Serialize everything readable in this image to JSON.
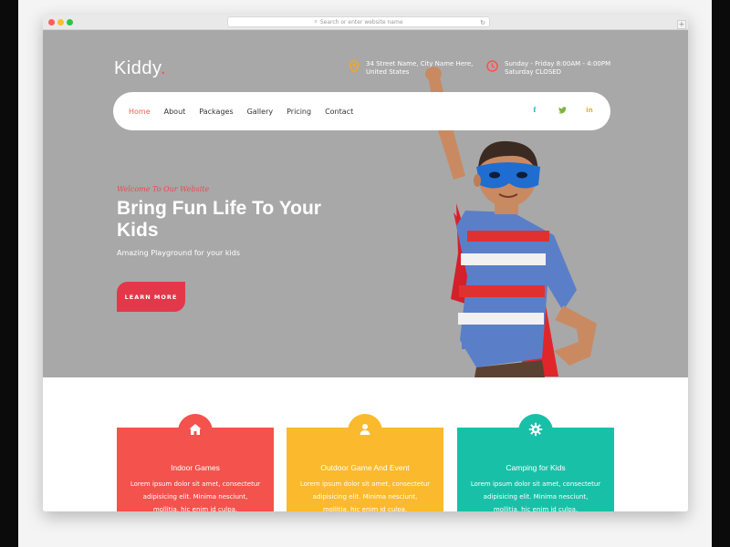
{
  "browser": {
    "address_placeholder": "Search or enter website name"
  },
  "header": {
    "logo_text": "Kiddy",
    "logo_dot": ".",
    "address_line1": "34 Street Name, City Name Here,",
    "address_line2": "United States",
    "hours_line1": "Sunday - Friday 8:00AM - 4:00PM",
    "hours_line2": "Saturday CLOSED"
  },
  "nav": {
    "items": [
      {
        "label": "Home",
        "active": true
      },
      {
        "label": "About",
        "active": false
      },
      {
        "label": "Packages",
        "active": false
      },
      {
        "label": "Gallery",
        "active": false
      },
      {
        "label": "Pricing",
        "active": false
      },
      {
        "label": "Contact",
        "active": false
      }
    ],
    "socials": [
      {
        "icon": "facebook-icon",
        "glyph": "f"
      },
      {
        "icon": "twitter-icon",
        "glyph": "🐦"
      },
      {
        "icon": "linkedin-icon",
        "glyph": "in"
      }
    ]
  },
  "hero": {
    "welcome": "Welcome To Our Website",
    "headline": "Bring Fun Life To Your Kids",
    "subline": "Amazing Playground for your kids",
    "cta": "LEARN MORE"
  },
  "features": [
    {
      "title": "Indoor Games",
      "icon": "home-icon",
      "color": "#f4524d",
      "body": "Lorem ipsum dolor sit amet, consectetur adipisicing elit. Minima nesciunt, mollitia, hic enim id culpa."
    },
    {
      "title": "Outdoor Game And Event",
      "icon": "user-icon",
      "color": "#fbb92d",
      "body": "Lorem ipsum dolor sit amet, consectetur adipisicing elit. Minima nesciunt, mollitia, hic enim id culpa."
    },
    {
      "title": "Camping for Kids",
      "icon": "gear-icon",
      "color": "#19c0a8",
      "body": "Lorem ipsum dolor sit amet, consectetur adipisicing elit. Minima nesciunt, mollitia, hic enim id culpa."
    }
  ],
  "colors": {
    "accent": "#ff5a4f",
    "cta": "#e3384a",
    "hero_bg": "#a8a8a8"
  }
}
